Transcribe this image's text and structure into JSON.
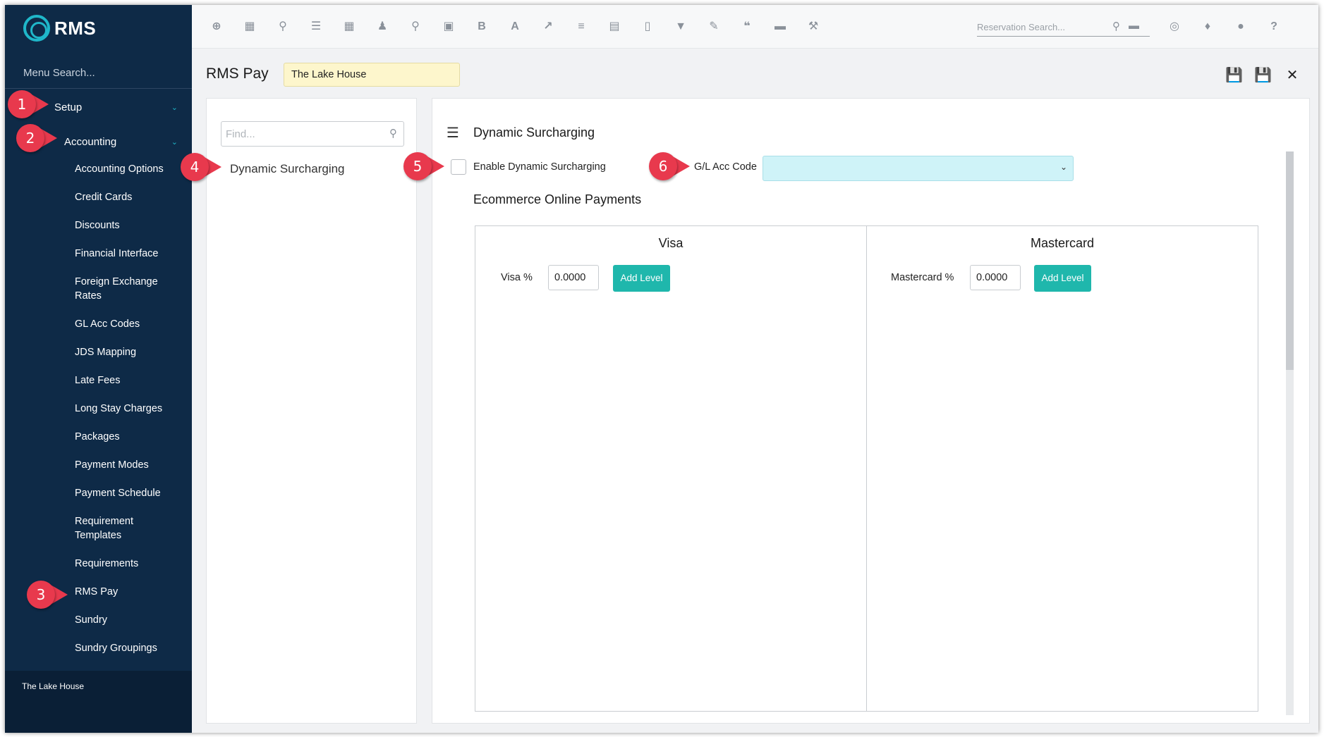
{
  "app": {
    "logo_text": "RMS"
  },
  "sidebar": {
    "menu_search_placeholder": "Menu Search...",
    "setup_label": "Setup",
    "accounting_label": "Accounting",
    "items": [
      {
        "label": "Accounting Options"
      },
      {
        "label": "Credit Cards"
      },
      {
        "label": "Discounts"
      },
      {
        "label": "Financial Interface"
      },
      {
        "label": "Foreign Exchange Rates"
      },
      {
        "label": "GL Acc Codes"
      },
      {
        "label": "JDS Mapping"
      },
      {
        "label": "Late Fees"
      },
      {
        "label": "Long Stay Charges"
      },
      {
        "label": "Packages"
      },
      {
        "label": "Payment Modes"
      },
      {
        "label": "Payment Schedule"
      },
      {
        "label": "Requirement Templates"
      },
      {
        "label": "Requirements"
      },
      {
        "label": "RMS Pay"
      },
      {
        "label": "Sundry"
      },
      {
        "label": "Sundry Groupings"
      }
    ],
    "footer_property": "The Lake House"
  },
  "toolbar": {
    "icons": [
      "add-circle-icon",
      "calendar-icon",
      "search-icon",
      "sliders-icon",
      "grid-icon",
      "guests-icon",
      "map-pin-icon",
      "map-icon",
      "bold-icon",
      "font-icon",
      "chart-line-icon",
      "checklist-icon",
      "id-card-icon",
      "document-icon",
      "cart-icon",
      "tag-edit-icon",
      "quote-icon",
      "bed-icon",
      "hammer-icon"
    ],
    "reservation_search_placeholder": "Reservation Search...",
    "right_icons": [
      "globe-icon",
      "bell-icon",
      "chat-icon",
      "help-icon"
    ]
  },
  "page": {
    "title": "RMS Pay",
    "property_value": "The Lake House"
  },
  "left_panel": {
    "find_placeholder": "Find...",
    "items": [
      {
        "label": "Dynamic Surcharging"
      }
    ]
  },
  "main": {
    "section_title": "Dynamic Surcharging",
    "enable_label": "Enable Dynamic Surcharging",
    "enable_checked": false,
    "gl_label": "G/L Acc Code",
    "gl_value": "",
    "ecommerce_title": "Ecommerce Online Payments",
    "cards": [
      {
        "title": "Visa",
        "pct_label": "Visa %",
        "pct_value": "0.0000",
        "button": "Add Level"
      },
      {
        "title": "Mastercard",
        "pct_label": "Mastercard %",
        "pct_value": "0.0000",
        "button": "Add Level"
      }
    ]
  },
  "callouts": [
    "1",
    "2",
    "3",
    "4",
    "5",
    "6"
  ],
  "colors": {
    "sidebar_bg": "#0e2a47",
    "accent_teal": "#1fb7ac",
    "logo_cyan": "#1fb7c9",
    "callout_red": "#e8394d",
    "property_field_bg": "#fdf6cc",
    "gl_select_bg": "#cff3f8"
  }
}
